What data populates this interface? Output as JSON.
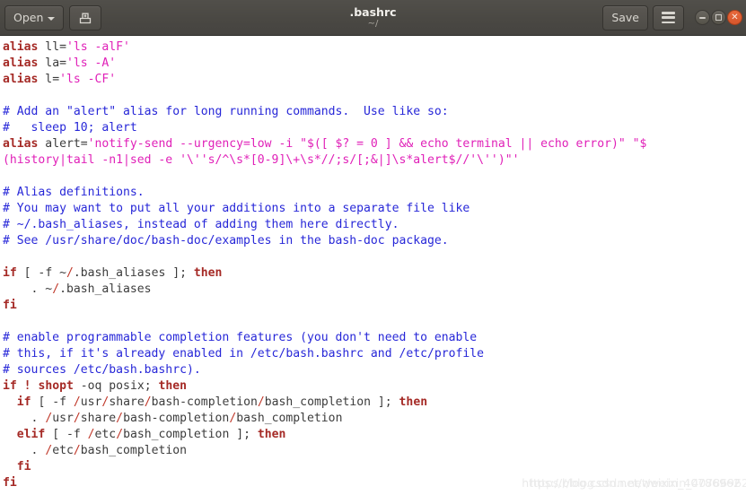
{
  "window": {
    "title": ".bashrc",
    "subtitle": "~/",
    "app": "gedit"
  },
  "toolbar": {
    "open_label": "Open",
    "open_icon": "chevron-down-icon",
    "save_as_icon": "save-as-icon",
    "save_label": "Save",
    "menu_icon": "hamburger-menu-icon"
  },
  "window_controls": {
    "minimize_icon": "minimize-icon",
    "maximize_icon": "maximize-icon",
    "close_icon": "close-icon",
    "close_color": "#d6562b"
  },
  "colors": {
    "titlebar_bg": "#4a4843",
    "editor_bg": "#ffffff",
    "keyword": "#a52a26",
    "string": "#e020b8",
    "comment": "#2727d8",
    "plain": "#3c3c3c",
    "slash": "#c0392b"
  },
  "watermark": {
    "text": "https://blog.csdn.net/weixin_40786962"
  },
  "editor": {
    "language": "bash",
    "filename": ".bashrc",
    "lines": [
      [
        {
          "t": "alias",
          "c": "k"
        },
        {
          "t": " ll=",
          "c": "p"
        },
        {
          "t": "'ls -alF'",
          "c": "s"
        }
      ],
      [
        {
          "t": "alias",
          "c": "k"
        },
        {
          "t": " la=",
          "c": "p"
        },
        {
          "t": "'ls -A'",
          "c": "s"
        }
      ],
      [
        {
          "t": "alias",
          "c": "k"
        },
        {
          "t": " l=",
          "c": "p"
        },
        {
          "t": "'ls -CF'",
          "c": "s"
        }
      ],
      [],
      [
        {
          "t": "# Add an \"alert\" alias for long running commands.  Use like so:",
          "c": "c"
        }
      ],
      [
        {
          "t": "#   sleep 10; alert",
          "c": "c"
        }
      ],
      [
        {
          "t": "alias",
          "c": "k"
        },
        {
          "t": " alert=",
          "c": "p"
        },
        {
          "t": "'notify-send --urgency=low -i \"$([ $? = 0 ] && echo terminal || echo error)\" \"$",
          "c": "s"
        }
      ],
      [
        {
          "t": "(history|tail -n1|sed -e '\\''s/^\\s*[0-9]\\+\\s*//;s/[;&|]\\s*alert$//'\\'')\"'",
          "c": "s"
        }
      ],
      [],
      [
        {
          "t": "# Alias definitions.",
          "c": "c"
        }
      ],
      [
        {
          "t": "# You may want to put all your additions into a separate file like",
          "c": "c"
        }
      ],
      [
        {
          "t": "# ~/.bash_aliases, instead of adding them here directly.",
          "c": "c"
        }
      ],
      [
        {
          "t": "# See /usr/share/doc/bash-doc/examples in the bash-doc package.",
          "c": "c"
        }
      ],
      [],
      [
        {
          "t": "if",
          "c": "k"
        },
        {
          "t": " [ -f ~",
          "c": "p"
        },
        {
          "t": "/",
          "c": "sl"
        },
        {
          "t": ".bash_aliases ]; ",
          "c": "p"
        },
        {
          "t": "then",
          "c": "k"
        }
      ],
      [
        {
          "t": "    . ~",
          "c": "p"
        },
        {
          "t": "/",
          "c": "sl"
        },
        {
          "t": ".bash_aliases",
          "c": "p"
        }
      ],
      [
        {
          "t": "fi",
          "c": "k"
        }
      ],
      [],
      [
        {
          "t": "# enable programmable completion features (you don't need to enable",
          "c": "c"
        }
      ],
      [
        {
          "t": "# this, if it's already enabled in /etc/bash.bashrc and /etc/profile",
          "c": "c"
        }
      ],
      [
        {
          "t": "# sources /etc/bash.bashrc).",
          "c": "c"
        }
      ],
      [
        {
          "t": "if",
          "c": "k"
        },
        {
          "t": " ",
          "c": "p"
        },
        {
          "t": "!",
          "c": "k"
        },
        {
          "t": " ",
          "c": "p"
        },
        {
          "t": "shopt",
          "c": "k"
        },
        {
          "t": " -oq posix; ",
          "c": "p"
        },
        {
          "t": "then",
          "c": "k"
        }
      ],
      [
        {
          "t": "  ",
          "c": "p"
        },
        {
          "t": "if",
          "c": "k"
        },
        {
          "t": " [ -f ",
          "c": "p"
        },
        {
          "t": "/",
          "c": "sl"
        },
        {
          "t": "usr",
          "c": "p"
        },
        {
          "t": "/",
          "c": "sl"
        },
        {
          "t": "share",
          "c": "p"
        },
        {
          "t": "/",
          "c": "sl"
        },
        {
          "t": "bash-completion",
          "c": "p"
        },
        {
          "t": "/",
          "c": "sl"
        },
        {
          "t": "bash_completion ]; ",
          "c": "p"
        },
        {
          "t": "then",
          "c": "k"
        }
      ],
      [
        {
          "t": "    . ",
          "c": "p"
        },
        {
          "t": "/",
          "c": "sl"
        },
        {
          "t": "usr",
          "c": "p"
        },
        {
          "t": "/",
          "c": "sl"
        },
        {
          "t": "share",
          "c": "p"
        },
        {
          "t": "/",
          "c": "sl"
        },
        {
          "t": "bash-completion",
          "c": "p"
        },
        {
          "t": "/",
          "c": "sl"
        },
        {
          "t": "bash_completion",
          "c": "p"
        }
      ],
      [
        {
          "t": "  ",
          "c": "p"
        },
        {
          "t": "elif",
          "c": "k"
        },
        {
          "t": " [ -f ",
          "c": "p"
        },
        {
          "t": "/",
          "c": "sl"
        },
        {
          "t": "etc",
          "c": "p"
        },
        {
          "t": "/",
          "c": "sl"
        },
        {
          "t": "bash_completion ]; ",
          "c": "p"
        },
        {
          "t": "then",
          "c": "k"
        }
      ],
      [
        {
          "t": "    . ",
          "c": "p"
        },
        {
          "t": "/",
          "c": "sl"
        },
        {
          "t": "etc",
          "c": "p"
        },
        {
          "t": "/",
          "c": "sl"
        },
        {
          "t": "bash_completion",
          "c": "p"
        }
      ],
      [
        {
          "t": "  ",
          "c": "p"
        },
        {
          "t": "fi",
          "c": "k"
        }
      ],
      [
        {
          "t": "fi",
          "c": "k"
        }
      ]
    ]
  }
}
